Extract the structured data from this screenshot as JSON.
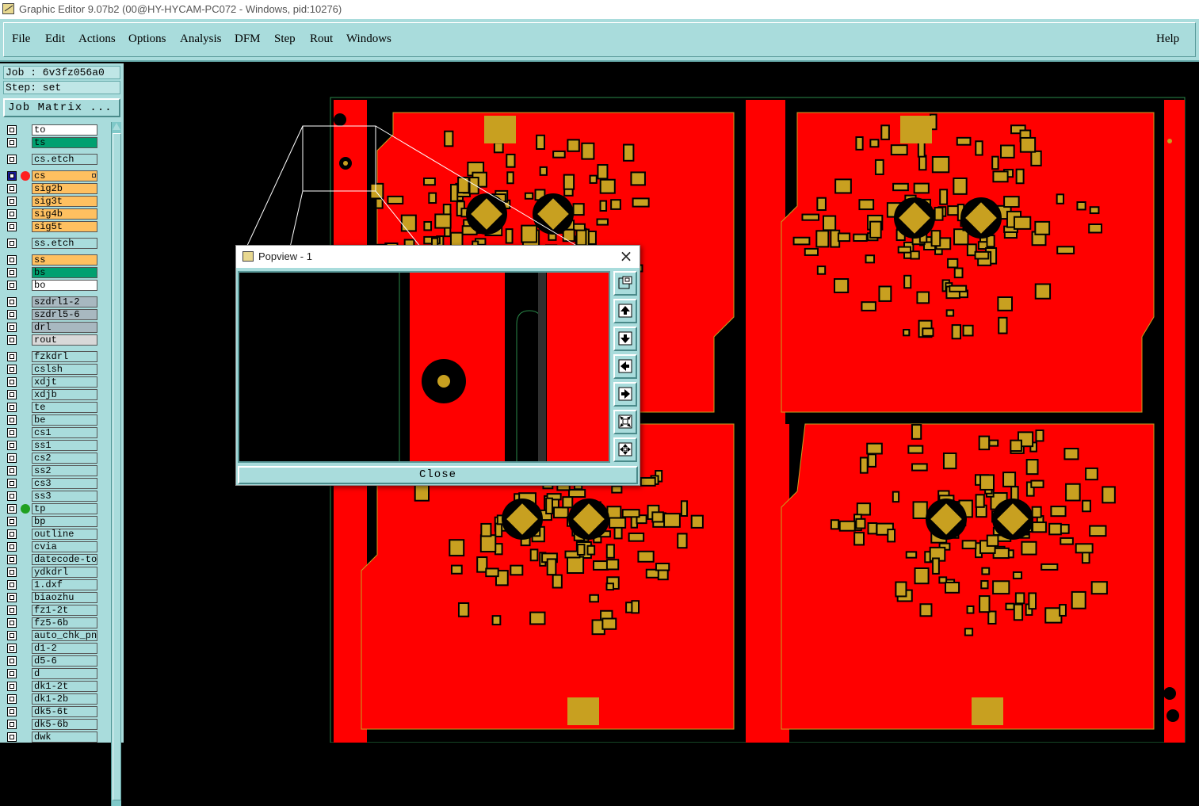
{
  "window": {
    "title": "Graphic Editor 9.07b2 (00@HY-HYCAM-PC072 - Windows, pid:10276)"
  },
  "menu": {
    "items": [
      "File",
      "Edit",
      "Actions",
      "Options",
      "Analysis",
      "DFM",
      "Step",
      "Rout",
      "Windows"
    ],
    "help": "Help"
  },
  "panel": {
    "job": "Job : 6v3fz056a0",
    "step": "Step: set",
    "job_matrix": "Job Matrix ..."
  },
  "colors": {
    "panel_bg": "#a9dcdc",
    "layer_cyan": "#a9dcdc",
    "layer_green": "#00a070",
    "layer_orange": "#ffc060",
    "layer_gray": "#c0c0c0",
    "layer_white": "#ffffff",
    "board_red": "#ff0000",
    "pad_gold": "#c8a020"
  },
  "layers": [
    {
      "name": "to",
      "color": "#ffffff"
    },
    {
      "name": "ts",
      "color": "#00a070"
    },
    {
      "name": "cs.etch",
      "color": "#a9dcdc"
    },
    {
      "name": "cs",
      "color": "#ffc060",
      "active": true,
      "dot": "#ff2020",
      "marker": true
    },
    {
      "name": "sig2b",
      "color": "#ffc060"
    },
    {
      "name": "sig3t",
      "color": "#ffc060"
    },
    {
      "name": "sig4b",
      "color": "#ffc060"
    },
    {
      "name": "sig5t",
      "color": "#ffc060"
    },
    {
      "name": "ss.etch",
      "color": "#a9dcdc"
    },
    {
      "name": "ss",
      "color": "#ffc060"
    },
    {
      "name": "bs",
      "color": "#00a070"
    },
    {
      "name": "bo",
      "color": "#ffffff"
    },
    {
      "name": "szdrl1-2",
      "color": "#a8b8c0"
    },
    {
      "name": "szdrl5-6",
      "color": "#a8b8c0"
    },
    {
      "name": "drl",
      "color": "#a8b8c0"
    },
    {
      "name": "rout",
      "color": "#d8d8d8"
    },
    {
      "name": "fzkdrl",
      "color": "#a9dcdc"
    },
    {
      "name": "cslsh",
      "color": "#a9dcdc"
    },
    {
      "name": "xdjt",
      "color": "#a9dcdc"
    },
    {
      "name": "xdjb",
      "color": "#a9dcdc"
    },
    {
      "name": "te",
      "color": "#a9dcdc"
    },
    {
      "name": "be",
      "color": "#a9dcdc"
    },
    {
      "name": "cs1",
      "color": "#a9dcdc"
    },
    {
      "name": "ss1",
      "color": "#a9dcdc"
    },
    {
      "name": "cs2",
      "color": "#a9dcdc"
    },
    {
      "name": "ss2",
      "color": "#a9dcdc"
    },
    {
      "name": "cs3",
      "color": "#a9dcdc"
    },
    {
      "name": "ss3",
      "color": "#a9dcdc"
    },
    {
      "name": "tp",
      "color": "#a9dcdc",
      "dot": "#20a020"
    },
    {
      "name": "bp",
      "color": "#a9dcdc"
    },
    {
      "name": "outline",
      "color": "#a9dcdc"
    },
    {
      "name": "cvia",
      "color": "#a9dcdc"
    },
    {
      "name": "datecode-to",
      "color": "#a9dcdc"
    },
    {
      "name": "ydkdrl",
      "color": "#a9dcdc"
    },
    {
      "name": "1.dxf",
      "color": "#a9dcdc"
    },
    {
      "name": "biaozhu",
      "color": "#a9dcdc"
    },
    {
      "name": "fz1-2t",
      "color": "#a9dcdc"
    },
    {
      "name": "fz5-6b",
      "color": "#a9dcdc"
    },
    {
      "name": "auto_chk_pn",
      "color": "#a9dcdc"
    },
    {
      "name": "d1-2",
      "color": "#a9dcdc"
    },
    {
      "name": "d5-6",
      "color": "#a9dcdc"
    },
    {
      "name": "d",
      "color": "#a9dcdc"
    },
    {
      "name": "dk1-2t",
      "color": "#a9dcdc"
    },
    {
      "name": "dk1-2b",
      "color": "#a9dcdc"
    },
    {
      "name": "dk5-6t",
      "color": "#a9dcdc"
    },
    {
      "name": "dk5-6b",
      "color": "#a9dcdc"
    },
    {
      "name": "dwk",
      "color": "#a9dcdc"
    }
  ],
  "popview": {
    "title": "Popview - 1",
    "close_label": "Close",
    "close_icon": "×",
    "tools": [
      "zoom-box-icon",
      "pan-up-icon",
      "pan-down-icon",
      "pan-left-icon",
      "pan-right-icon",
      "zoom-in-icon",
      "zoom-fit-icon"
    ]
  }
}
